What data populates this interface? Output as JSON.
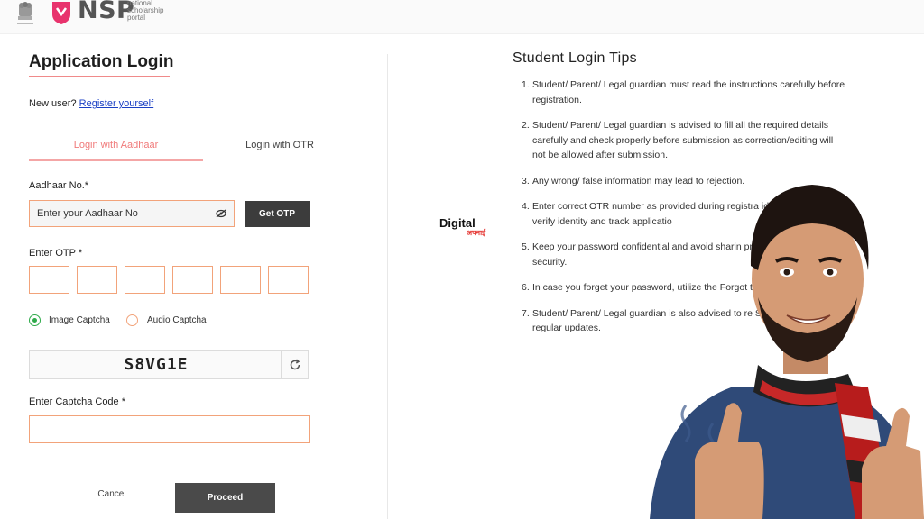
{
  "header": {
    "logo_text": "NSP",
    "logo_subtitle_line1": "national",
    "logo_subtitle_line2": "scholarship",
    "logo_subtitle_line3": "portal"
  },
  "form": {
    "title": "Application Login",
    "new_user_text": "New user?",
    "register_link": "Register yourself",
    "tabs": [
      {
        "label": "Login with Aadhaar",
        "active": true
      },
      {
        "label": "Login with OTR",
        "active": false
      }
    ],
    "aadhaar_label": "Aadhaar No.*",
    "aadhaar_placeholder": "Enter your Aadhaar No",
    "get_otp_label": "Get OTP",
    "otp_label": "Enter OTP *",
    "otp_boxes": 6,
    "captcha_options": [
      {
        "label": "Image Captcha",
        "selected": true
      },
      {
        "label": "Audio Captcha",
        "selected": false
      }
    ],
    "captcha_value": "S8VG1E",
    "captcha_code_label": "Enter Captcha Code *",
    "cancel_label": "Cancel",
    "proceed_label": "Proceed"
  },
  "tips": {
    "title": "Student Login Tips",
    "items": [
      {
        "num": "1.",
        "text": "Student/ Parent/ Legal guardian must read the instructions carefully before registration."
      },
      {
        "num": "2.",
        "text": "Student/ Parent/ Legal guardian is advised to fill all the required details carefully and check properly before submission as correction/editing will not be allowed after submission."
      },
      {
        "num": "3.",
        "text": "Any wrong/ false information may lead to rejection."
      },
      {
        "num": "4.",
        "text": "Enter correct OTR number as provided during registra identifier helps to verify identity and track applicatio"
      },
      {
        "num": "5.",
        "text": "Keep your password confidential and avoid sharin protect your account security."
      },
      {
        "num": "6.",
        "text": "In case you forget your password, utilize the Forgot to reset it."
      },
      {
        "num": "7.",
        "text": "Student/ Parent/ Legal guardian is also advised to re Scholarship Portal for regular updates."
      }
    ]
  },
  "watermark": {
    "main": "Digital",
    "sub": "अपनाई"
  },
  "colors": {
    "accent": "#f07a7a",
    "input_border": "#f2a37a",
    "button_dark": "#3c3c3c",
    "radio_on": "#2eaa4a",
    "link": "#1a3fc4"
  }
}
